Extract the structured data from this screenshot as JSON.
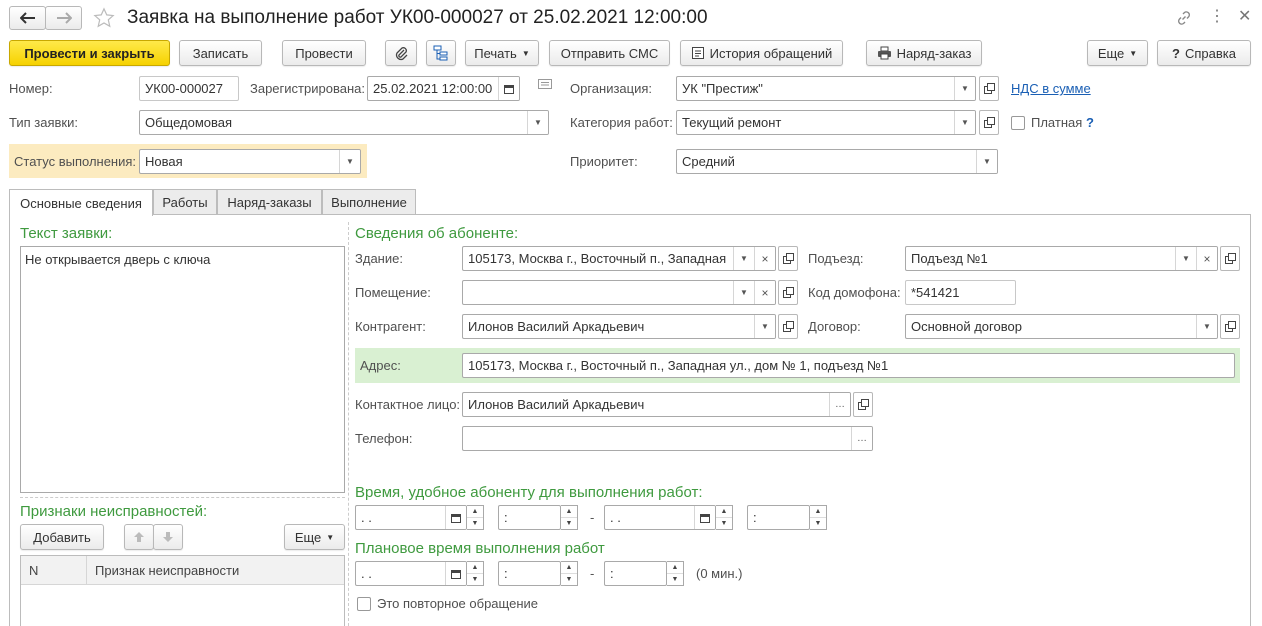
{
  "window": {
    "title": "Заявка на выполнение работ УК00-000027 от 25.02.2021 12:00:00"
  },
  "toolbar": {
    "post_close": "Провести и закрыть",
    "write": "Записать",
    "post": "Провести",
    "print": "Печать",
    "send_sms": "Отправить СМС",
    "history": "История обращений",
    "work_order": "Наряд-заказ",
    "more": "Еще",
    "help": "Справка"
  },
  "header": {
    "number_label": "Номер:",
    "number_value": "УК00-000027",
    "registered_label": "Зарегистрирована:",
    "registered_value": "25.02.2021 12:00:00",
    "org_label": "Организация:",
    "org_value": "УК \"Престиж\"",
    "vat_link": "НДС в сумме",
    "type_label": "Тип заявки:",
    "type_value": "Общедомовая",
    "category_label": "Категория работ:",
    "category_value": "Текущий ремонт",
    "paid_label": "Платная",
    "paid_help": "?",
    "status_label": "Статус выполнения:",
    "status_value": "Новая",
    "priority_label": "Приоритет:",
    "priority_value": "Средний"
  },
  "tabs": [
    "Основные сведения",
    "Работы",
    "Наряд-заказы",
    "Выполнение"
  ],
  "left": {
    "request_text_title": "Текст заявки:",
    "request_text": "Не открывается дверь с ключа",
    "faults_title": "Признаки неисправностей:",
    "add_button": "Добавить",
    "more_button": "Еще",
    "col_n": "N",
    "col_fault": "Признак неисправности"
  },
  "subscriber": {
    "title": "Сведения об абоненте:",
    "building_label": "Здание:",
    "building_value": "105173, Москва г., Восточный п., Западная",
    "entrance_label": "Подъезд:",
    "entrance_value": "Подъезд №1",
    "room_label": "Помещение:",
    "room_value": "",
    "intercom_label": "Код домофона:",
    "intercom_value": "*541421",
    "contractor_label": "Контрагент:",
    "contractor_value": "Илонов Василий Аркадьевич",
    "contract_label": "Договор:",
    "contract_value": "Основной договор",
    "address_label": "Адрес:",
    "address_value": "105173, Москва г., Восточный п., Западная ул., дом № 1, подъезд №1",
    "contact_label": "Контактное лицо:",
    "contact_value": "Илонов Василий Аркадьевич",
    "phone_label": "Телефон:",
    "phone_value": ""
  },
  "time": {
    "convenient_title": "Время, удобное абоненту для выполнения работ:",
    "planned_title": "Плановое время выполнения работ",
    "date_placeholder": " .  .",
    "time_placeholder": " :",
    "dash": "-",
    "minutes": "(0 мин.)",
    "repeat_label": "Это повторное обращение"
  },
  "colors": {
    "accent_green": "#3f9a3f",
    "status_highlight": "#fcebc0",
    "address_highlight": "#d9f0d2",
    "primary_button": "#f6d200",
    "link": "#1a5fb4"
  }
}
